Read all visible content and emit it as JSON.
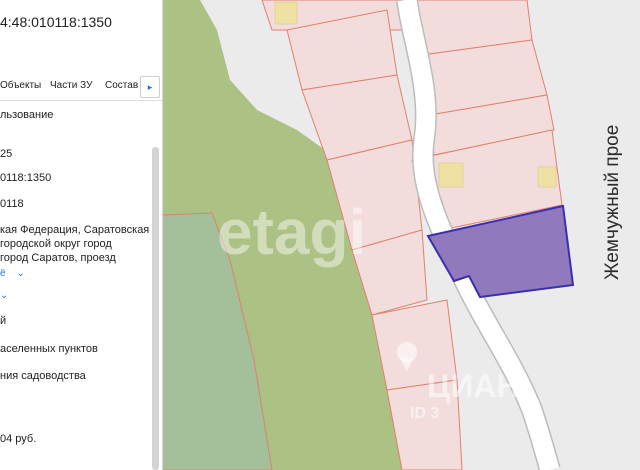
{
  "panel": {
    "cadastral_number": "4:48:010118:1350",
    "tabs": [
      "Объекты",
      "Части ЗУ",
      "Состав"
    ],
    "tab_next_glyph": "▸",
    "rows": [
      "льзование",
      "25",
      "0118:1350",
      "0118",
      "кая Федерация, Саратовская",
      "городской округ город",
      "город Саратов, проезд",
      "ё",
      "й",
      "аселенных пунктов",
      "ния садоводства",
      "04 руб."
    ],
    "chevron": "⌄"
  },
  "map": {
    "street_label": "Жемчужный прое",
    "watermark": "etagi",
    "watermark_cian": "ЦИАН",
    "watermark_cian_sub": "ID 3"
  },
  "colors": {
    "parcel_fill": "#f3dddc",
    "parcel_border": "#e0806c",
    "green_field": "#acc184",
    "green_field_dark": "#a3c09b",
    "selected_parcel": "#9079bd",
    "selected_border": "#3a2fb0",
    "building": "#efe1a3",
    "road": "#ffffff",
    "road_edge": "#bcbcbc",
    "background": "#ebebeb"
  }
}
